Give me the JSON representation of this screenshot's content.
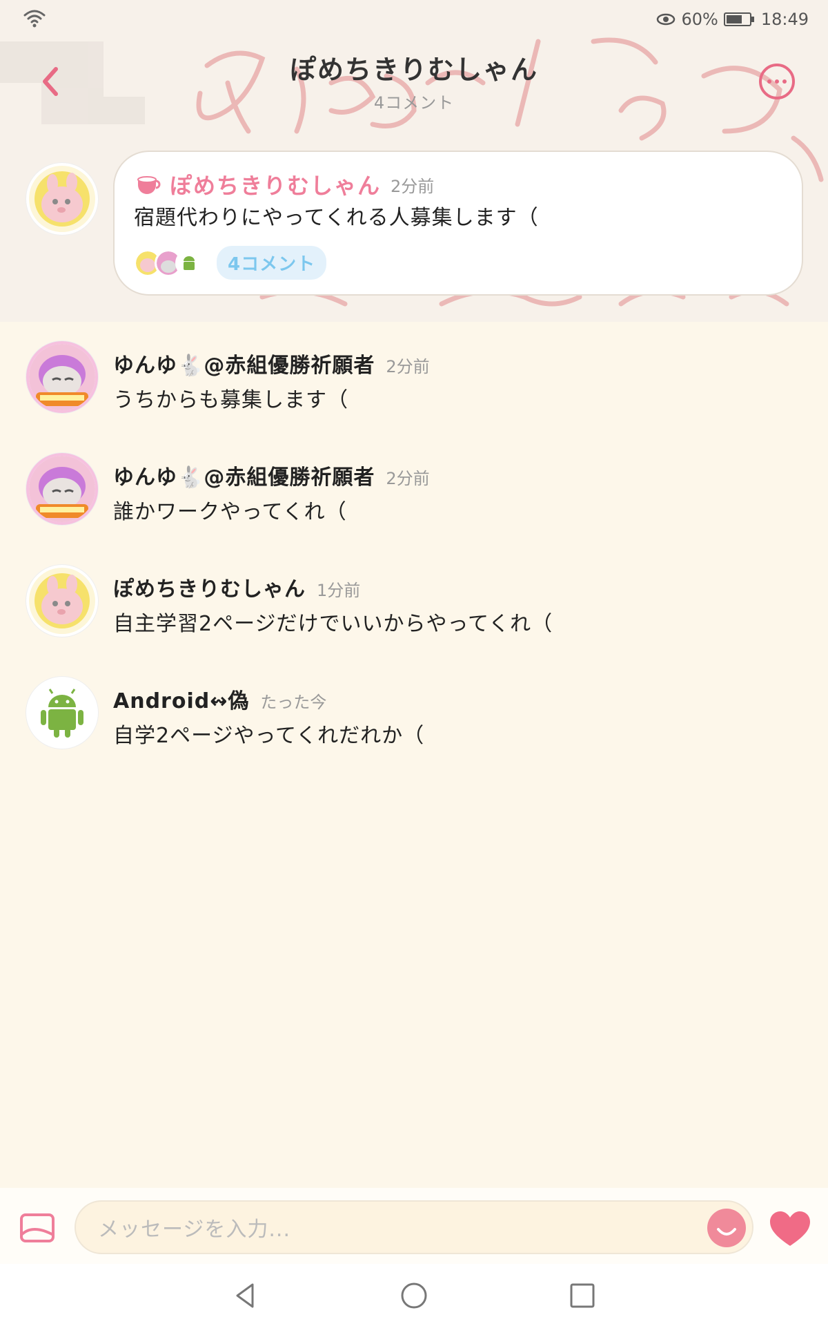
{
  "status_bar": {
    "battery_percent": "60%",
    "time": "18:49"
  },
  "header": {
    "title": "ぽめちきりむしゃん",
    "subtitle": "4コメント"
  },
  "post": {
    "author": "ぽめちきりむしゃん",
    "time": "2分前",
    "text": "宿題代わりにやってくれる人募集します（",
    "comment_count_label": "4コメント"
  },
  "comments": [
    {
      "name": "ゆんゆ🐇@赤組優勝祈願者",
      "time": "2分前",
      "text": "うちからも募集します（"
    },
    {
      "name": "ゆんゆ🐇@赤組優勝祈願者",
      "time": "2分前",
      "text": "誰かワークやってくれ（"
    },
    {
      "name": "ぽめちきりむしゃん",
      "time": "1分前",
      "text": "自主学習2ページだけでいいからやってくれ（"
    },
    {
      "name": "Android↭偽",
      "time": "たった今",
      "text": "自学2ページやってくれだれか（"
    }
  ],
  "input": {
    "placeholder": "メッセージを入力..."
  },
  "colors": {
    "accent_pink": "#ef7e9a",
    "background": "#fdf7ea",
    "pill_blue": "#7cc7ee"
  },
  "icons": [
    "wifi-icon",
    "eye-icon",
    "battery-icon",
    "back-icon",
    "more-icon",
    "cup-icon",
    "image-icon",
    "emoji-icon",
    "heart-icon",
    "nav-back-icon",
    "nav-home-icon",
    "nav-recent-icon"
  ]
}
